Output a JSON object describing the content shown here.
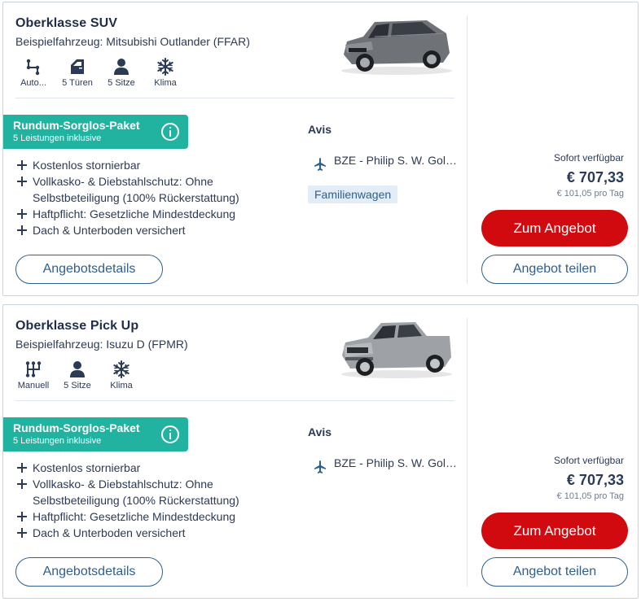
{
  "offers": [
    {
      "title": "Oberklasse SUV",
      "example": "Beispielfahrzeug: Mitsubishi Outlander (FFAR)",
      "features": [
        {
          "icon": "automatic-gear-icon",
          "label": "Auto..."
        },
        {
          "icon": "car-door-icon",
          "label": "5 Türen"
        },
        {
          "icon": "person-icon",
          "label": "5 Sitze"
        },
        {
          "icon": "snowflake-icon",
          "label": "Klima"
        }
      ],
      "package": {
        "title": "Rundum-Sorglos-Paket",
        "subtitle": "5 Leistungen inklusive"
      },
      "benefits": [
        "Kostenlos stornierbar",
        "Vollkasko- & Diebstahlschutz: Ohne Selbstbeteiligung (100% Rückerstattung)",
        "Haftpflicht: Gesetzliche Mindestdeckung",
        "Dach & Unterboden versichert"
      ],
      "details_label": "Angebotsdetails",
      "vendor": "Avis",
      "location": "BZE - Philip S. W. Gold...",
      "tag": "Familienwagen",
      "availability": "Sofort verfügbar",
      "price": "€ 707,33",
      "per_day": "€ 101,05 pro Tag",
      "cta_label": "Zum Angebot",
      "share_label": "Angebot teilen"
    },
    {
      "title": "Oberklasse Pick Up",
      "example": "Beispielfahrzeug: Isuzu D (FPMR)",
      "features": [
        {
          "icon": "manual-gear-icon",
          "label": "Manuell"
        },
        {
          "icon": "person-icon",
          "label": "5 Sitze"
        },
        {
          "icon": "snowflake-icon",
          "label": "Klima"
        }
      ],
      "package": {
        "title": "Rundum-Sorglos-Paket",
        "subtitle": "5 Leistungen inklusive"
      },
      "benefits": [
        "Kostenlos stornierbar",
        "Vollkasko- & Diebstahlschutz: Ohne Selbstbeteiligung (100% Rückerstattung)",
        "Haftpflicht: Gesetzliche Mindestdeckung",
        "Dach & Unterboden versichert"
      ],
      "details_label": "Angebotsdetails",
      "vendor": "Avis",
      "location": "BZE - Philip S. W. Gold...",
      "availability": "Sofort verfügbar",
      "price": "€ 707,33",
      "per_day": "€ 101,05 pro Tag",
      "cta_label": "Zum Angebot",
      "share_label": "Angebot teilen"
    }
  ],
  "colors": {
    "primary_button": "#d10a0f",
    "package_badge": "#21b3a0",
    "link_blue": "#2f5f8f",
    "tag_background": "#e3edf8"
  }
}
